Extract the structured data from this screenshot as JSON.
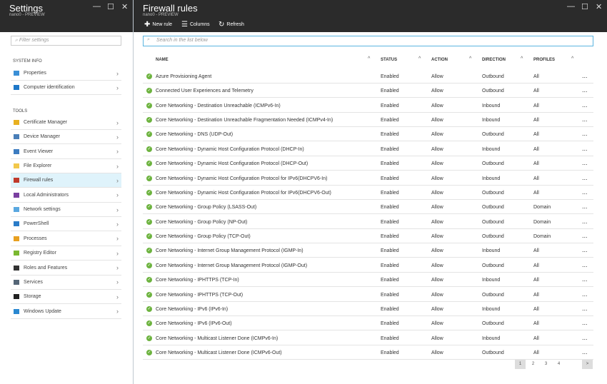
{
  "settings": {
    "title": "Settings",
    "subtitle": "nano0 - PREVIEW",
    "filter_placeholder": "Filter settings",
    "sections": [
      {
        "label": "SYSTEM INFO",
        "items": [
          {
            "label": "Properties",
            "color": "#3a8fd6"
          },
          {
            "label": "Computer identification",
            "color": "#1e78c8"
          }
        ]
      },
      {
        "label": "TOOLS",
        "items": [
          {
            "label": "Certificate Manager",
            "color": "#e8b020"
          },
          {
            "label": "Device Manager",
            "color": "#4a7fb8"
          },
          {
            "label": "Event Viewer",
            "color": "#3c7cc0"
          },
          {
            "label": "File Explorer",
            "color": "#f2c84b"
          },
          {
            "label": "Firewall rules",
            "color": "#c0392b",
            "selected": true
          },
          {
            "label": "Local Administrators",
            "color": "#7a3fa0"
          },
          {
            "label": "Network settings",
            "color": "#5aa8e0"
          },
          {
            "label": "PowerShell",
            "color": "#2a7cc8"
          },
          {
            "label": "Processes",
            "color": "#e8a020"
          },
          {
            "label": "Registry Editor",
            "color": "#7ab830"
          },
          {
            "label": "Roles and Features",
            "color": "#333333"
          },
          {
            "label": "Services",
            "color": "#556677"
          },
          {
            "label": "Storage",
            "color": "#222222"
          },
          {
            "label": "Windows Update",
            "color": "#2a88d0"
          }
        ]
      }
    ]
  },
  "firewall": {
    "title": "Firewall rules",
    "subtitle": "nano0 - PREVIEW",
    "toolbar": {
      "new_rule": "New rule",
      "columns": "Columns",
      "refresh": "Refresh"
    },
    "search_placeholder": "Search in the list below",
    "columns": [
      "NAME",
      "STATUS",
      "ACTION",
      "DIRECTION",
      "PROFILES"
    ],
    "rows": [
      [
        "Azure Provisioning Agent",
        "Enabled",
        "Allow",
        "Outbound",
        "All"
      ],
      [
        "Connected User Experiences and Telemetry",
        "Enabled",
        "Allow",
        "Outbound",
        "All"
      ],
      [
        "Core Networking - Destination Unreachable (ICMPv6-In)",
        "Enabled",
        "Allow",
        "Inbound",
        "All"
      ],
      [
        "Core Networking - Destination Unreachable Fragmentation Needed (ICMPv4-In)",
        "Enabled",
        "Allow",
        "Inbound",
        "All"
      ],
      [
        "Core Networking - DNS (UDP-Out)",
        "Enabled",
        "Allow",
        "Outbound",
        "All"
      ],
      [
        "Core Networking - Dynamic Host Configuration Protocol (DHCP-In)",
        "Enabled",
        "Allow",
        "Inbound",
        "All"
      ],
      [
        "Core Networking - Dynamic Host Configuration Protocol (DHCP-Out)",
        "Enabled",
        "Allow",
        "Outbound",
        "All"
      ],
      [
        "Core Networking - Dynamic Host Configuration Protocol for IPv6(DHCPV6-In)",
        "Enabled",
        "Allow",
        "Inbound",
        "All"
      ],
      [
        "Core Networking - Dynamic Host Configuration Protocol for IPv6(DHCPV6-Out)",
        "Enabled",
        "Allow",
        "Outbound",
        "All"
      ],
      [
        "Core Networking - Group Policy (LSASS-Out)",
        "Enabled",
        "Allow",
        "Outbound",
        "Domain"
      ],
      [
        "Core Networking - Group Policy (NP-Out)",
        "Enabled",
        "Allow",
        "Outbound",
        "Domain"
      ],
      [
        "Core Networking - Group Policy (TCP-Out)",
        "Enabled",
        "Allow",
        "Outbound",
        "Domain"
      ],
      [
        "Core Networking - Internet Group Management Protocol (IGMP-In)",
        "Enabled",
        "Allow",
        "Inbound",
        "All"
      ],
      [
        "Core Networking - Internet Group Management Protocol (IGMP-Out)",
        "Enabled",
        "Allow",
        "Outbound",
        "All"
      ],
      [
        "Core Networking - IPHTTPS (TCP-In)",
        "Enabled",
        "Allow",
        "Inbound",
        "All"
      ],
      [
        "Core Networking - IPHTTPS (TCP-Out)",
        "Enabled",
        "Allow",
        "Outbound",
        "All"
      ],
      [
        "Core Networking - IPv6 (IPv6-In)",
        "Enabled",
        "Allow",
        "Inbound",
        "All"
      ],
      [
        "Core Networking - IPv6 (IPv6-Out)",
        "Enabled",
        "Allow",
        "Outbound",
        "All"
      ],
      [
        "Core Networking - Multicast Listener Done (ICMPv6-In)",
        "Enabled",
        "Allow",
        "Inbound",
        "All"
      ],
      [
        "Core Networking - Multicast Listener Done (ICMPv6-Out)",
        "Enabled",
        "Allow",
        "Outbound",
        "All"
      ]
    ],
    "more": "...",
    "pagination": {
      "pages": [
        "1",
        "2",
        "3",
        "4"
      ],
      "current": "1",
      "next": ">"
    }
  }
}
